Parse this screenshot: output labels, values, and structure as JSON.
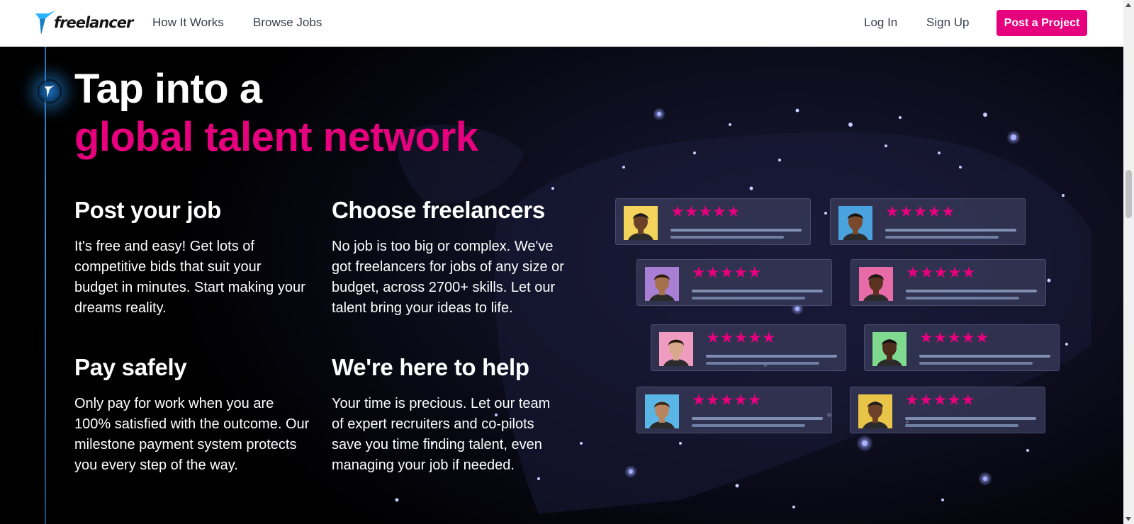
{
  "nav": {
    "logo_text": "freelancer",
    "how_it_works": "How It Works",
    "browse_jobs": "Browse Jobs",
    "log_in": "Log In",
    "sign_up": "Sign Up",
    "post_project": "Post a Project"
  },
  "hero": {
    "title_line1": "Tap into a",
    "title_line2": "global talent network",
    "features": [
      {
        "heading": "Post your job",
        "text": "It's free and easy! Get lots of competitive bids that suit your budget in minutes. Start making your dreams reality."
      },
      {
        "heading": "Choose freelancers",
        "text": "No job is too big or complex. We've got freelancers for jobs of any size or budget, across 2700+ skills. Let our talent bring your ideas to life."
      },
      {
        "heading": "Pay safely",
        "text": "Only pay for work when you are 100% satisfied with the outcome. Our milestone payment system protects you every step of the way."
      },
      {
        "heading": "We're here to help",
        "text": "Your time is precious. Let our team of expert recruiters and co-pilots save you time finding talent, even managing your job if needed."
      }
    ],
    "rating_stars": "★★★★★",
    "accent_color": "#e6007e"
  },
  "cards": [
    {
      "avatar_bg": "#f3d35b",
      "skin": "#6b4128",
      "hair": "#1a1a1a"
    },
    {
      "avatar_bg": "#4aa3df",
      "skin": "#7a4a2c",
      "hair": "#141414"
    },
    {
      "avatar_bg": "#a97fd6",
      "skin": "#a5704a",
      "hair": "#2a1a12"
    },
    {
      "avatar_bg": "#e76ba6",
      "skin": "#5a3320",
      "hair": "#171717"
    },
    {
      "avatar_bg": "#ef9cc0",
      "skin": "#d7a98a",
      "hair": "#241712"
    },
    {
      "avatar_bg": "#7fd98f",
      "skin": "#4e2c1c",
      "hair": "#111111"
    },
    {
      "avatar_bg": "#5bb6e8",
      "skin": "#b98560",
      "hair": "#3a2516"
    },
    {
      "avatar_bg": "#e8c548",
      "skin": "#6e4128",
      "hair": "#1b1b1b"
    }
  ]
}
